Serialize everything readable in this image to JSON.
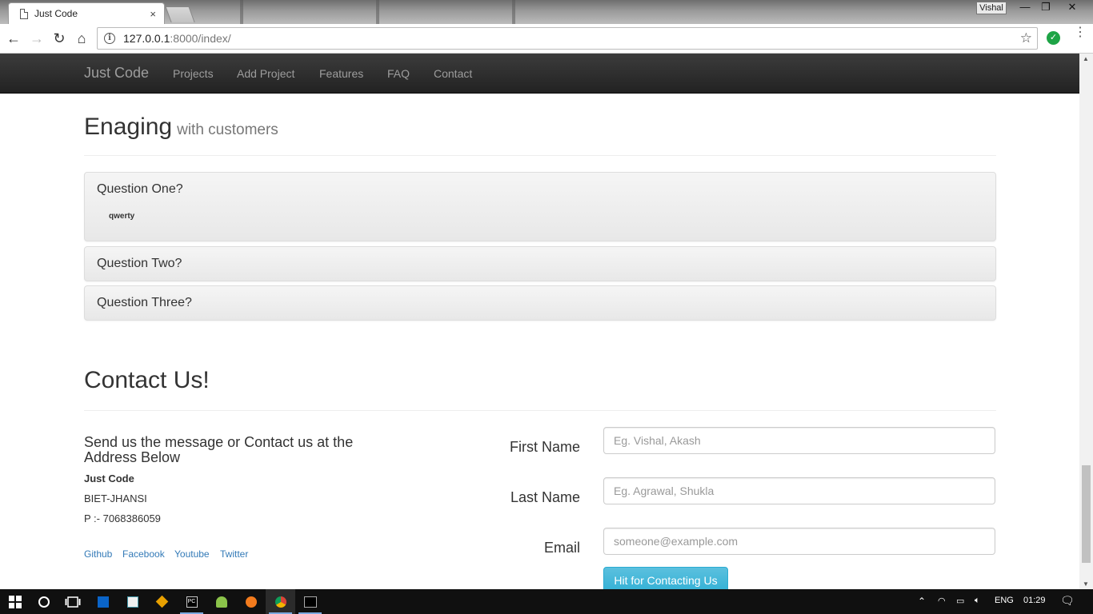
{
  "browser": {
    "tab_title": "Just Code",
    "tab_close": "×",
    "profile_name": "Vishal",
    "url_host": "127.0.0.1",
    "url_path": ":8000/index/",
    "window_controls": [
      "—",
      "❐",
      "✕"
    ]
  },
  "navbar": {
    "brand": "Just Code",
    "links": [
      "Projects",
      "Add Project",
      "Features",
      "FAQ",
      "Contact"
    ]
  },
  "faq": {
    "title": "Enaging",
    "subtitle": "with customers",
    "questions": [
      {
        "q": "Question One?",
        "a": "qwerty"
      },
      {
        "q": "Question Two?"
      },
      {
        "q": "Question Three?"
      }
    ]
  },
  "contact": {
    "title": "Contact Us!",
    "lead": "Send us the message or Contact us at the Address Below",
    "org": "Just Code",
    "location": "BIET-JHANSI",
    "phone": "P :- 7068386059",
    "social": [
      "Github",
      "Facebook",
      "Youtube",
      "Twitter"
    ],
    "form": {
      "first_name_label": "First Name",
      "first_name_placeholder": "Eg. Vishal, Akash",
      "last_name_label": "Last Name",
      "last_name_placeholder": "Eg. Agrawal, Shukla",
      "email_label": "Email",
      "email_placeholder": "someone@example.com",
      "submit_label": "Hit for Contacting Us"
    }
  },
  "taskbar": {
    "language": "ENG",
    "time": "01:29"
  },
  "colors": {
    "navbar_bg": "#222222",
    "link": "#337ab7",
    "submit": "#5bc0de",
    "taskbar": "#101010"
  }
}
